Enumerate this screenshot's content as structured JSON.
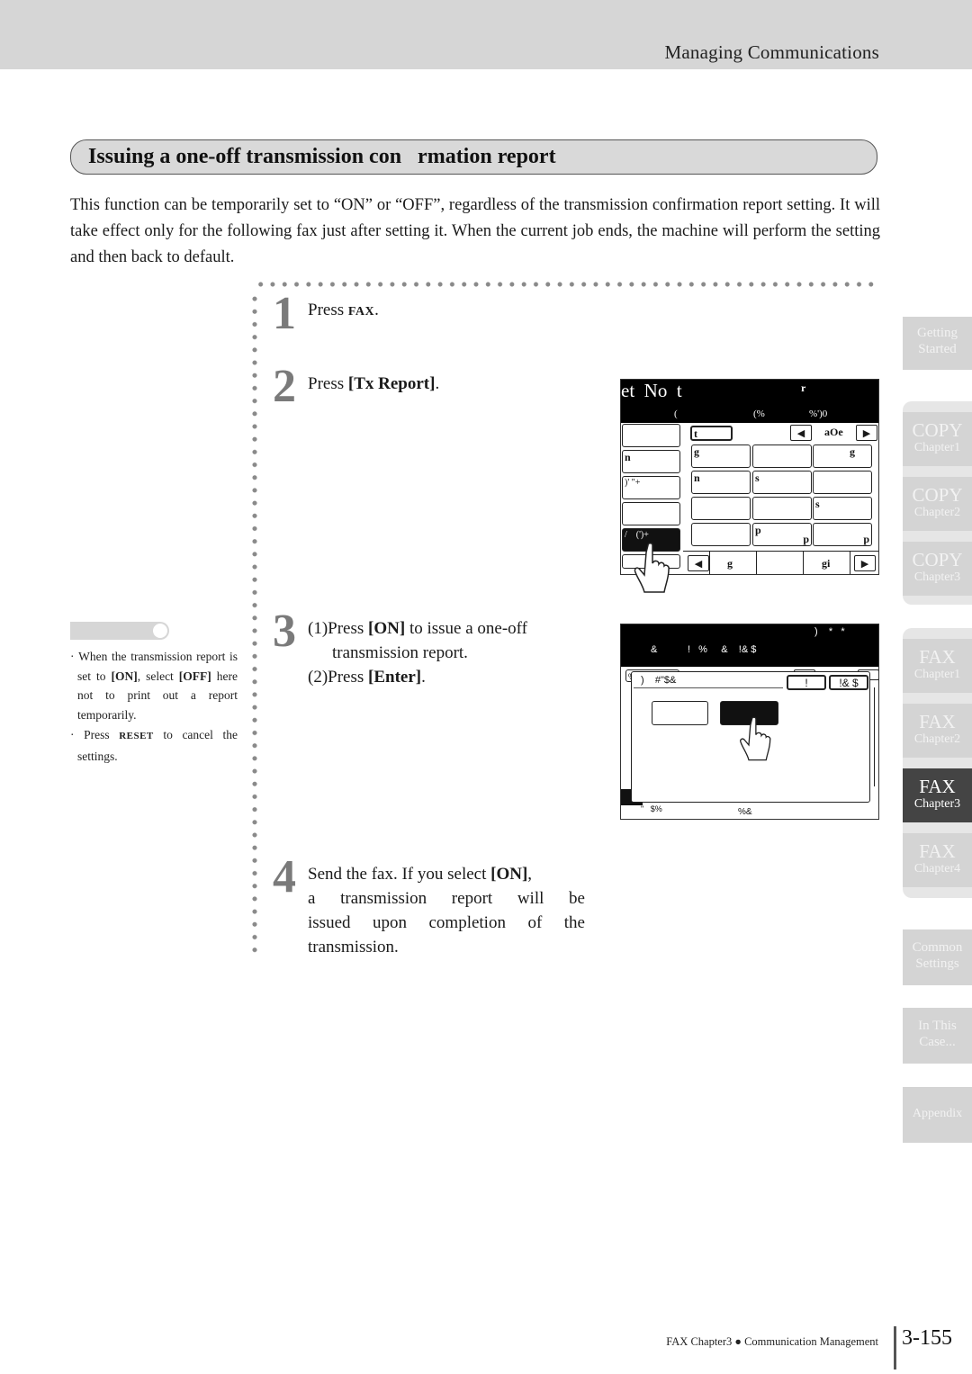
{
  "header": {
    "title": "Managing Communications"
  },
  "section": {
    "title": "Issuing a one-off transmission con   rmation report"
  },
  "intro": "This function can be temporarily set to “ON” or “OFF”, regardless of the transmission confirmation report setting. It will take effect only for the following fax just after setting it. When the current job ends, the machine will perform the setting and then back to default.",
  "steps": [
    {
      "num": "1",
      "prefix": "Press ",
      "key": "FAX",
      "suffix": "."
    },
    {
      "num": "2",
      "prefix": "Press ",
      "key": "[Tx Report]",
      "suffix": "."
    },
    {
      "num": "3",
      "sub1_label": "(1)",
      "sub1_prefix": "Press ",
      "sub1_key": "[ON]",
      "sub1_suffix": " to issue a one-off",
      "sub1_line2": "transmission report.",
      "sub2_label": "(2)",
      "sub2_prefix": "Press ",
      "sub2_key": "[Enter]",
      "sub2_suffix": "."
    },
    {
      "num": "4",
      "line1_prefix": "Send the fax. If you select ",
      "line1_key": "[ON]",
      "line1_suffix": ",",
      "line2": "a transmission report will be",
      "line3": "issued upon completion of the",
      "line4": "transmission."
    }
  ],
  "notes": [
    {
      "prefix": "When the transmission report is set to ",
      "key1": "[ON]",
      "mid": ", select ",
      "key2": "[OFF]",
      "suffix": " here not to print out a report temporarily."
    },
    {
      "prefix": "Press ",
      "key": "RESET",
      "suffix": " to cancel the settings."
    }
  ],
  "screen1": {
    "title_left": "et  No  t",
    "title_right": "r",
    "sub_a": "(",
    "sub_b": "(%",
    "sub_c": "%')0",
    "tab_label": "t",
    "page_label": "aOe",
    "left_buttons": [
      "",
      "n",
      ")'     \"+",
      "",
      "/    (')+",
      ""
    ],
    "grid": [
      [
        "g",
        "",
        "g"
      ],
      [
        "n",
        "s",
        ""
      ],
      [
        "",
        "",
        "s"
      ],
      [
        "",
        "p",
        "p"
      ]
    ],
    "grid_br": [
      [
        "",
        "",
        ""
      ],
      [
        "",
        "",
        ""
      ],
      [
        "",
        "",
        ""
      ],
      [
        "",
        "p",
        "p"
      ]
    ],
    "bottom_left": "g",
    "bottom_right": "gi"
  },
  "screen2": {
    "head_top": ")    *   *",
    "head_sub": "&           !   %     &    !& $",
    "behind_tab": "%\"  '&  !",
    "dialog_title": ")    #\"$&",
    "dialog_btn1": "!",
    "dialog_btn2": "!& $",
    "option_off": "",
    "option_on": "",
    "bottom_text": "%&",
    "bottom_left_text": "\"   $%"
  },
  "side_tabs": [
    {
      "big": "Getting",
      "small": "Started",
      "style": "two-line"
    },
    {
      "big": "COPY",
      "small": "Chapter1"
    },
    {
      "big": "COPY",
      "small": "Chapter2"
    },
    {
      "big": "COPY",
      "small": "Chapter3"
    },
    {
      "big": "FAX",
      "small": "Chapter1"
    },
    {
      "big": "FAX",
      "small": "Chapter2"
    },
    {
      "big": "FAX",
      "small": "Chapter3",
      "active": true
    },
    {
      "big": "FAX",
      "small": "Chapter4"
    },
    {
      "big": "Common",
      "small": "Settings",
      "style": "two-line"
    },
    {
      "big": "In This",
      "small": "Case...",
      "style": "two-line"
    },
    {
      "big": "Appendix",
      "small": "",
      "style": "single"
    }
  ],
  "footer": {
    "text": "FAX Chapter3 ● Communication Management",
    "page": "3-155"
  },
  "colors": {
    "header_band": "#d6d6d6",
    "tab_inactive": "#d4d4d4",
    "tab_active": "#444444",
    "step_number": "#7a7a7a"
  }
}
